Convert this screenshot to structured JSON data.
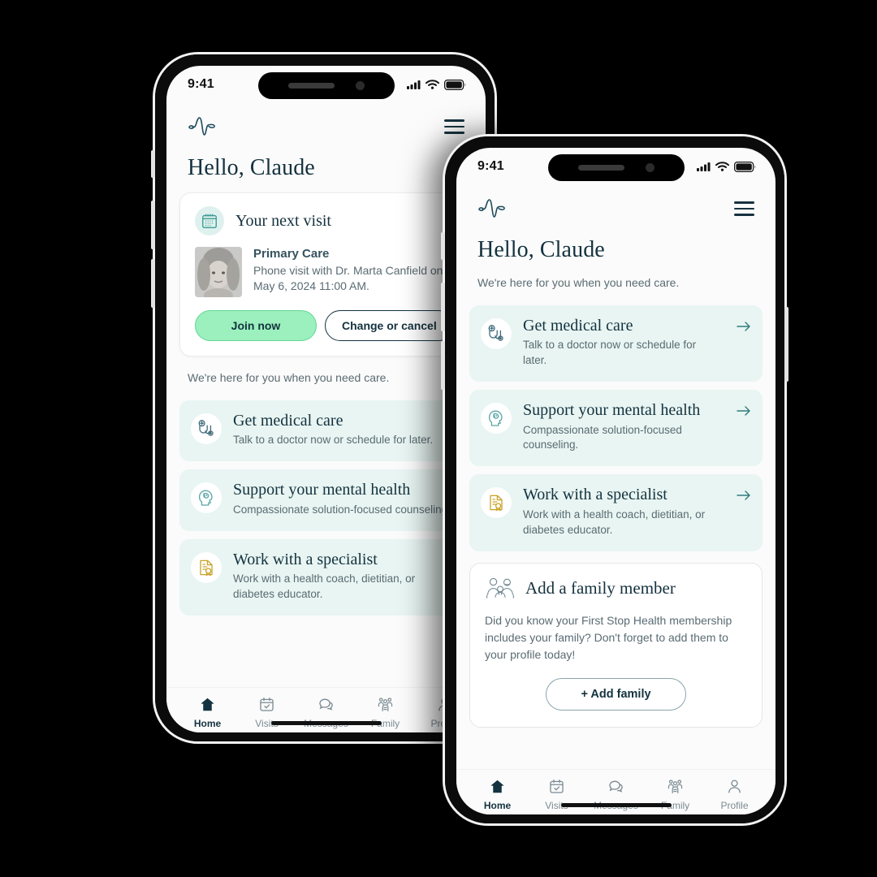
{
  "theme": {
    "dark_teal": "#14323f",
    "muted_text": "#5a6b73",
    "card_mint": "#e8f5f2",
    "join_green": "#9bf0bd",
    "arrow_teal": "#2f7c7c",
    "gold": "#c9a227",
    "page_bg": "#000000",
    "screen_bg": "#fbfbfb"
  },
  "status_bar": {
    "time": "9:41",
    "icons": [
      "cellular-signal-icon",
      "wifi-icon",
      "battery-icon"
    ]
  },
  "app_bar": {
    "logo": "pulse-wave-logo",
    "menu": "hamburger-menu-icon"
  },
  "greeting": "Hello, Claude",
  "subline": "We're here for you when you need care.",
  "next_visit": {
    "icon": "calendar-icon",
    "title": "Your next visit",
    "avatar": "doctor-avatar",
    "specialty": "Primary Care",
    "details": "Phone visit with Dr. Marta Canfield on May 6, 2024 11:00 AM.",
    "join_label": "Join now",
    "change_label": "Change or cancel"
  },
  "services": [
    {
      "icon": "stethoscope-icon",
      "title": "Get medical care",
      "desc": "Talk to a doctor now or schedule for later.",
      "arrow": "arrow-right-icon"
    },
    {
      "icon": "head-brain-icon",
      "title": "Support your mental health",
      "desc": "Compassionate solution-focused counseling.",
      "arrow": "arrow-right-icon"
    },
    {
      "icon": "certificate-document-icon",
      "title": "Work with a specialist",
      "desc": "Work with a health coach, dietitian, or diabetes educator.",
      "arrow": "arrow-right-icon"
    }
  ],
  "family_card": {
    "icon": "family-group-icon",
    "title": "Add a family member",
    "body": "Did you know your First Stop Health membership includes your family? Don't forget to add them to your profile today!",
    "button_label": "+ Add family"
  },
  "tabs": [
    {
      "label": "Home",
      "icon": "home-icon",
      "active": true
    },
    {
      "label": "Visits",
      "icon": "calendar-check-icon",
      "active": false
    },
    {
      "label": "Messages",
      "icon": "chat-bubbles-icon",
      "active": false
    },
    {
      "label": "Family",
      "icon": "family-icon",
      "active": false
    },
    {
      "label": "Profile",
      "icon": "person-icon",
      "active": false
    }
  ]
}
